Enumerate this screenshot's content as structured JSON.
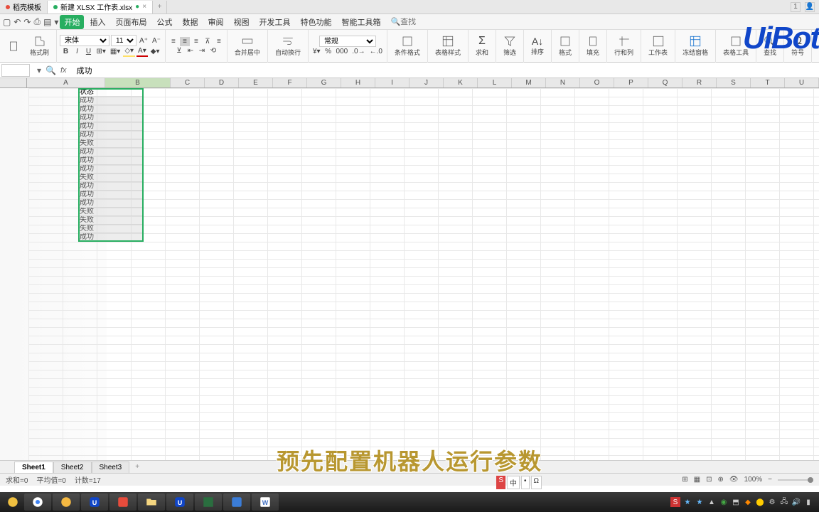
{
  "tabs": {
    "t1": "稻壳模板",
    "t2": "新建 XLSX 工作表.xlsx"
  },
  "topright_badge": "1",
  "menu": {
    "start": "开始",
    "insert": "插入",
    "page": "页面布局",
    "formula": "公式",
    "data": "数据",
    "review": "审阅",
    "view": "视图",
    "dev": "开发工具",
    "special": "特色功能",
    "smart": "智能工具箱",
    "search": "查找"
  },
  "toolbar": {
    "paste": "格式刷",
    "font_name": "宋体",
    "font_size": "11",
    "num_fmt": "常规",
    "merge": "合并居中",
    "wrap": "自动换行",
    "cond": "条件格式",
    "tblstyle": "表格样式",
    "sum": "求和",
    "filter": "筛选",
    "sort": "排序",
    "format": "格式",
    "fill": "填充",
    "rowcol": "行和列",
    "sheet": "工作表",
    "freeze": "冻结窗格",
    "tools": "表格工具",
    "find": "查找",
    "symbol": "符号"
  },
  "logo": "UiBot",
  "formula_bar": {
    "fx": "fx",
    "value": "成功"
  },
  "columns": [
    "A",
    "B",
    "C",
    "D",
    "E",
    "F",
    "G",
    "H",
    "I",
    "J",
    "K",
    "L",
    "M",
    "N",
    "O",
    "P",
    "Q",
    "R",
    "S",
    "T",
    "U"
  ],
  "col_b_data": [
    "状态",
    "成功",
    "成功",
    "成功",
    "成功",
    "成功",
    "失败",
    "成功",
    "成功",
    "成功",
    "失败",
    "成功",
    "成功",
    "成功",
    "失败",
    "失败",
    "失败",
    "成功"
  ],
  "sheets": {
    "s1": "Sheet1",
    "s2": "Sheet2",
    "s3": "Sheet3"
  },
  "status": {
    "sum": "求和=0",
    "avg": "平均值=0",
    "count": "计数=17",
    "zoom": "100%"
  },
  "caption": "预先配置机器人运行参数",
  "ime": {
    "a": "S",
    "b": "中"
  },
  "col_widths": {
    "A": 110,
    "B": 92,
    "other": 48
  }
}
